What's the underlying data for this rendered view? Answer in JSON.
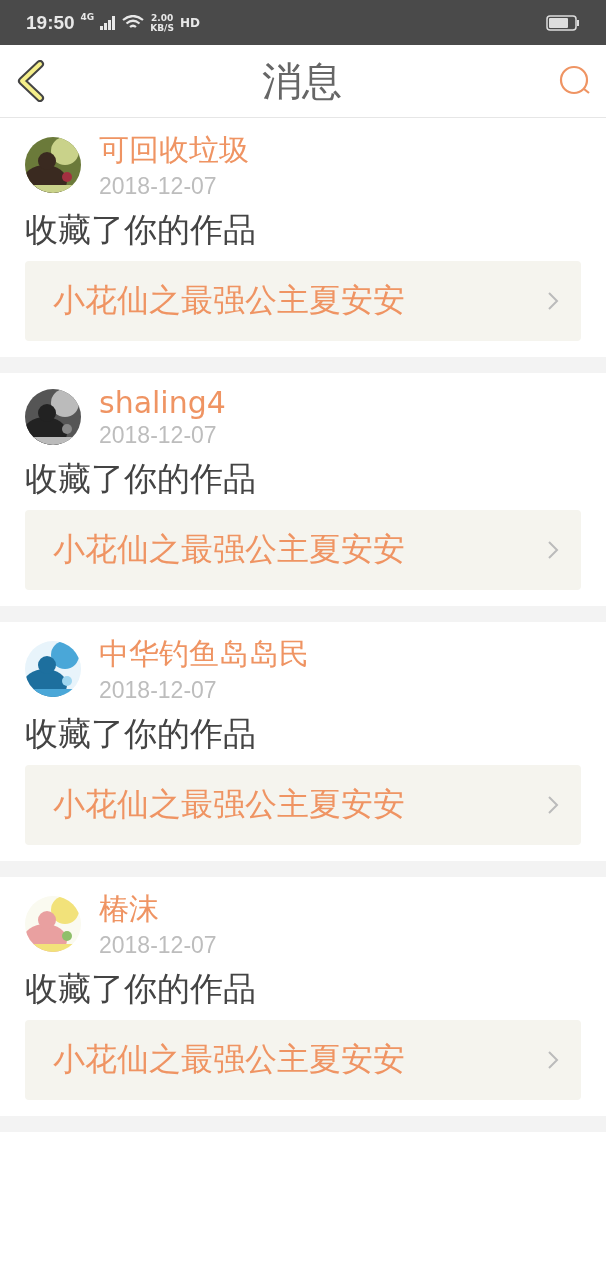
{
  "status_bar": {
    "time": "19:50",
    "network": "4G",
    "speed": "2.00",
    "speed_unit": "KB/S",
    "hd": "HD"
  },
  "nav": {
    "title": "消息"
  },
  "messages": [
    {
      "user": "可回收垃圾",
      "date": "2018-12-07",
      "action": "收藏了你的作品",
      "work": "小花仙之最强公主夏安安"
    },
    {
      "user": "shaling4",
      "date": "2018-12-07",
      "action": "收藏了你的作品",
      "work": "小花仙之最强公主夏安安"
    },
    {
      "user": "中华钓鱼岛岛民",
      "date": "2018-12-07",
      "action": "收藏了你的作品",
      "work": "小花仙之最强公主夏安安"
    },
    {
      "user": "椿沫",
      "date": "2018-12-07",
      "action": "收藏了你的作品",
      "work": "小花仙之最强公主夏安安"
    }
  ]
}
